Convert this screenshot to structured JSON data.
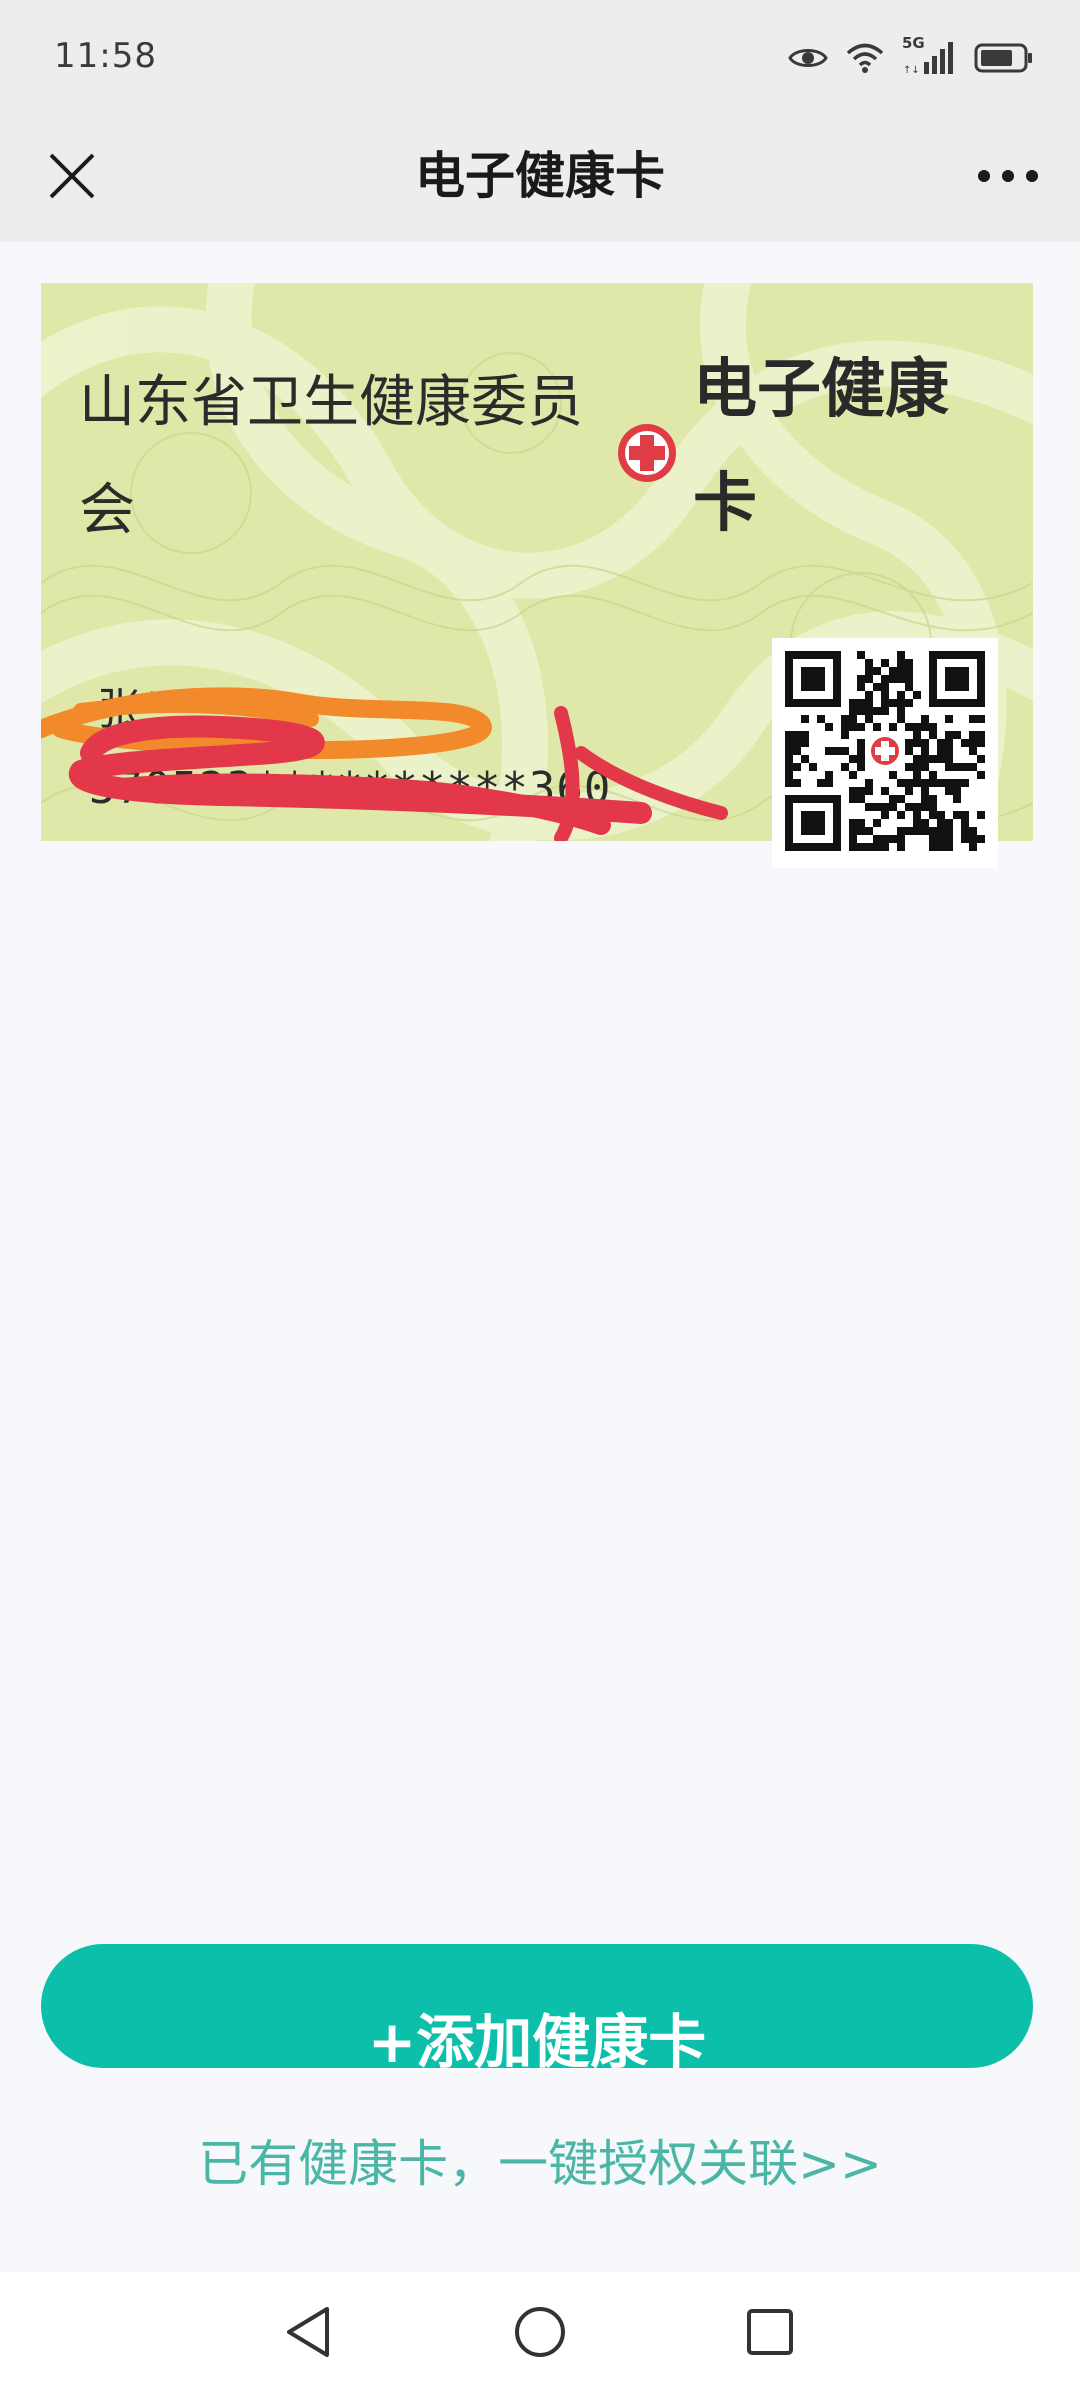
{
  "status_bar": {
    "time": "11:58",
    "network": "5G"
  },
  "header": {
    "title": "电子健康卡"
  },
  "card": {
    "issuer": "山东省卫生健康委员会",
    "title": "电子健康卡",
    "holder_name": "张**",
    "holder_id": "370523**********360"
  },
  "actions": {
    "add_button": "+添加健康卡",
    "link_auth": "已有健康卡，一键授权关联>>"
  },
  "icons": {
    "close": "close-icon",
    "more": "more-icon",
    "back": "back-icon",
    "home": "home-icon",
    "recents": "recents-icon"
  },
  "colors": {
    "accent": "#0bbfaa",
    "link": "#4bb6a5",
    "card": "#dfe8a8"
  }
}
